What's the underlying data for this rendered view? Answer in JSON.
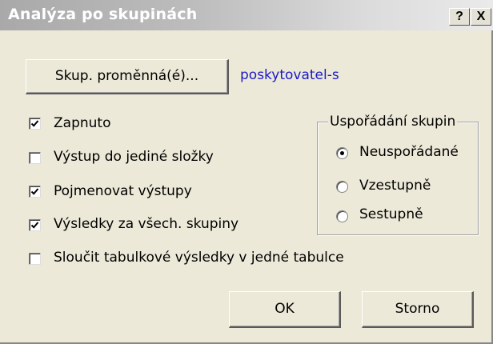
{
  "window": {
    "title": "Analýza po skupinách",
    "help_label": "?",
    "close_label": "X"
  },
  "group_var": {
    "button_label": "Skup. proměnná(é)...",
    "value": "poskytovatel-s"
  },
  "checkboxes": [
    {
      "label": "Zapnuto",
      "checked": true
    },
    {
      "label": "Výstup do jediné složky",
      "checked": false
    },
    {
      "label": "Pojmenovat výstupy",
      "checked": true
    },
    {
      "label": "Výsledky za všech. skupiny",
      "checked": true
    },
    {
      "label": "Sloučit tabulkové výsledky v jedné tabulce",
      "checked": false
    }
  ],
  "sort_group": {
    "title": "Uspořádání skupin",
    "options": [
      {
        "label": "Neuspořádané",
        "selected": true
      },
      {
        "label": "Vzestupně",
        "selected": false
      },
      {
        "label": "Sestupně",
        "selected": false
      }
    ]
  },
  "buttons": {
    "ok_label": "OK",
    "cancel_label": "Storno"
  }
}
